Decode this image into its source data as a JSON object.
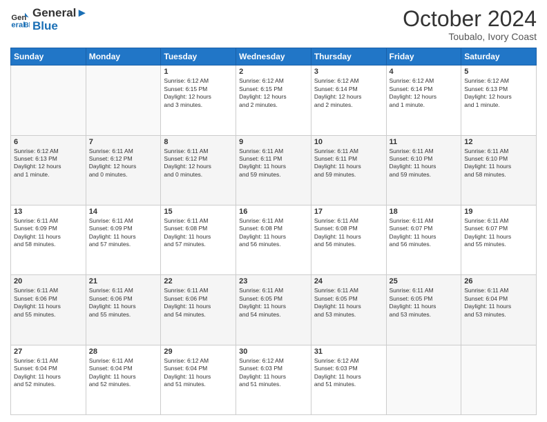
{
  "header": {
    "logo_line1": "General",
    "logo_line2": "Blue",
    "month": "October 2024",
    "location": "Toubalo, Ivory Coast"
  },
  "days_of_week": [
    "Sunday",
    "Monday",
    "Tuesday",
    "Wednesday",
    "Thursday",
    "Friday",
    "Saturday"
  ],
  "weeks": [
    [
      {
        "day": "",
        "info": ""
      },
      {
        "day": "",
        "info": ""
      },
      {
        "day": "1",
        "info": "Sunrise: 6:12 AM\nSunset: 6:15 PM\nDaylight: 12 hours\nand 3 minutes."
      },
      {
        "day": "2",
        "info": "Sunrise: 6:12 AM\nSunset: 6:15 PM\nDaylight: 12 hours\nand 2 minutes."
      },
      {
        "day": "3",
        "info": "Sunrise: 6:12 AM\nSunset: 6:14 PM\nDaylight: 12 hours\nand 2 minutes."
      },
      {
        "day": "4",
        "info": "Sunrise: 6:12 AM\nSunset: 6:14 PM\nDaylight: 12 hours\nand 1 minute."
      },
      {
        "day": "5",
        "info": "Sunrise: 6:12 AM\nSunset: 6:13 PM\nDaylight: 12 hours\nand 1 minute."
      }
    ],
    [
      {
        "day": "6",
        "info": "Sunrise: 6:12 AM\nSunset: 6:13 PM\nDaylight: 12 hours\nand 1 minute."
      },
      {
        "day": "7",
        "info": "Sunrise: 6:11 AM\nSunset: 6:12 PM\nDaylight: 12 hours\nand 0 minutes."
      },
      {
        "day": "8",
        "info": "Sunrise: 6:11 AM\nSunset: 6:12 PM\nDaylight: 12 hours\nand 0 minutes."
      },
      {
        "day": "9",
        "info": "Sunrise: 6:11 AM\nSunset: 6:11 PM\nDaylight: 11 hours\nand 59 minutes."
      },
      {
        "day": "10",
        "info": "Sunrise: 6:11 AM\nSunset: 6:11 PM\nDaylight: 11 hours\nand 59 minutes."
      },
      {
        "day": "11",
        "info": "Sunrise: 6:11 AM\nSunset: 6:10 PM\nDaylight: 11 hours\nand 59 minutes."
      },
      {
        "day": "12",
        "info": "Sunrise: 6:11 AM\nSunset: 6:10 PM\nDaylight: 11 hours\nand 58 minutes."
      }
    ],
    [
      {
        "day": "13",
        "info": "Sunrise: 6:11 AM\nSunset: 6:09 PM\nDaylight: 11 hours\nand 58 minutes."
      },
      {
        "day": "14",
        "info": "Sunrise: 6:11 AM\nSunset: 6:09 PM\nDaylight: 11 hours\nand 57 minutes."
      },
      {
        "day": "15",
        "info": "Sunrise: 6:11 AM\nSunset: 6:08 PM\nDaylight: 11 hours\nand 57 minutes."
      },
      {
        "day": "16",
        "info": "Sunrise: 6:11 AM\nSunset: 6:08 PM\nDaylight: 11 hours\nand 56 minutes."
      },
      {
        "day": "17",
        "info": "Sunrise: 6:11 AM\nSunset: 6:08 PM\nDaylight: 11 hours\nand 56 minutes."
      },
      {
        "day": "18",
        "info": "Sunrise: 6:11 AM\nSunset: 6:07 PM\nDaylight: 11 hours\nand 56 minutes."
      },
      {
        "day": "19",
        "info": "Sunrise: 6:11 AM\nSunset: 6:07 PM\nDaylight: 11 hours\nand 55 minutes."
      }
    ],
    [
      {
        "day": "20",
        "info": "Sunrise: 6:11 AM\nSunset: 6:06 PM\nDaylight: 11 hours\nand 55 minutes."
      },
      {
        "day": "21",
        "info": "Sunrise: 6:11 AM\nSunset: 6:06 PM\nDaylight: 11 hours\nand 55 minutes."
      },
      {
        "day": "22",
        "info": "Sunrise: 6:11 AM\nSunset: 6:06 PM\nDaylight: 11 hours\nand 54 minutes."
      },
      {
        "day": "23",
        "info": "Sunrise: 6:11 AM\nSunset: 6:05 PM\nDaylight: 11 hours\nand 54 minutes."
      },
      {
        "day": "24",
        "info": "Sunrise: 6:11 AM\nSunset: 6:05 PM\nDaylight: 11 hours\nand 53 minutes."
      },
      {
        "day": "25",
        "info": "Sunrise: 6:11 AM\nSunset: 6:05 PM\nDaylight: 11 hours\nand 53 minutes."
      },
      {
        "day": "26",
        "info": "Sunrise: 6:11 AM\nSunset: 6:04 PM\nDaylight: 11 hours\nand 53 minutes."
      }
    ],
    [
      {
        "day": "27",
        "info": "Sunrise: 6:11 AM\nSunset: 6:04 PM\nDaylight: 11 hours\nand 52 minutes."
      },
      {
        "day": "28",
        "info": "Sunrise: 6:11 AM\nSunset: 6:04 PM\nDaylight: 11 hours\nand 52 minutes."
      },
      {
        "day": "29",
        "info": "Sunrise: 6:12 AM\nSunset: 6:04 PM\nDaylight: 11 hours\nand 51 minutes."
      },
      {
        "day": "30",
        "info": "Sunrise: 6:12 AM\nSunset: 6:03 PM\nDaylight: 11 hours\nand 51 minutes."
      },
      {
        "day": "31",
        "info": "Sunrise: 6:12 AM\nSunset: 6:03 PM\nDaylight: 11 hours\nand 51 minutes."
      },
      {
        "day": "",
        "info": ""
      },
      {
        "day": "",
        "info": ""
      }
    ]
  ]
}
